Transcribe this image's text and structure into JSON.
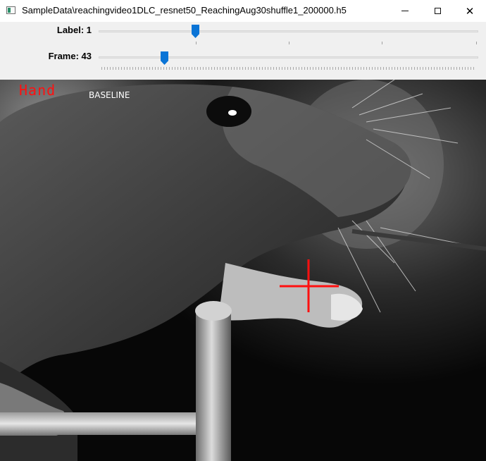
{
  "window": {
    "title": "SampleData\\reachingvideo1DLC_resnet50_ReachingAug30shuffle1_200000.h5",
    "close_glyph": "✕"
  },
  "controls": {
    "label_slider": {
      "label": "Label: 1",
      "value": 1,
      "icon": "slider-thumb"
    },
    "frame_slider": {
      "label": "Frame: 43",
      "value": 43,
      "icon": "slider-thumb"
    }
  },
  "video": {
    "body_part_label": "Hand",
    "status_label": "BASELINE",
    "marker_color": "#ff1010",
    "marker_icon": "crosshair-marker"
  },
  "colors": {
    "accent": "#0a74d6",
    "marker": "#ff1010"
  }
}
